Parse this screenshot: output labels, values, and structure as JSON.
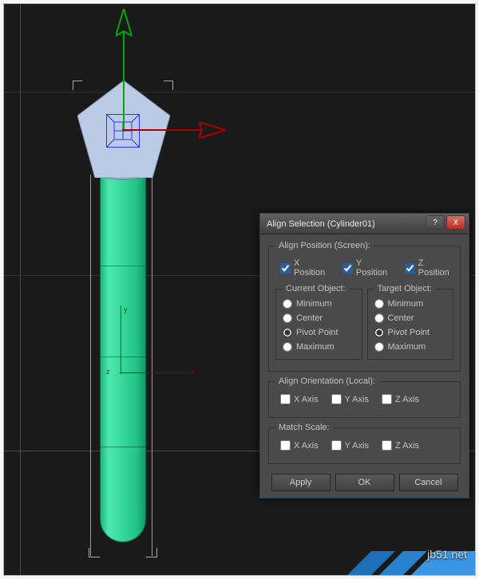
{
  "dialog": {
    "title": "Align Selection (Cylinder01)",
    "position_group": "Align Position (Screen):",
    "x_position": "X Position",
    "y_position": "Y Position",
    "z_position": "Z Position",
    "x_checked": true,
    "y_checked": true,
    "z_checked": true,
    "current_object": "Current Object:",
    "target_object": "Target Object:",
    "opt_minimum": "Minimum",
    "opt_center": "Center",
    "opt_pivot": "Pivot Point",
    "opt_maximum": "Maximum",
    "current_selected": "pivot",
    "target_selected": "pivot",
    "orientation_group": "Align Orientation (Local):",
    "x_axis": "X Axis",
    "y_axis": "Y Axis",
    "z_axis": "Z Axis",
    "orient_x": false,
    "orient_y": false,
    "orient_z": false,
    "scale_group": "Match Scale:",
    "scale_x": false,
    "scale_y": false,
    "scale_z": false,
    "btn_apply": "Apply",
    "btn_ok": "OK",
    "btn_cancel": "Cancel"
  },
  "viewport": {
    "axis_x": "x",
    "axis_y": "y",
    "axis_z": "z"
  },
  "watermark": "jb51.net",
  "titlebar_icons": {
    "help": "?",
    "close": "X"
  }
}
